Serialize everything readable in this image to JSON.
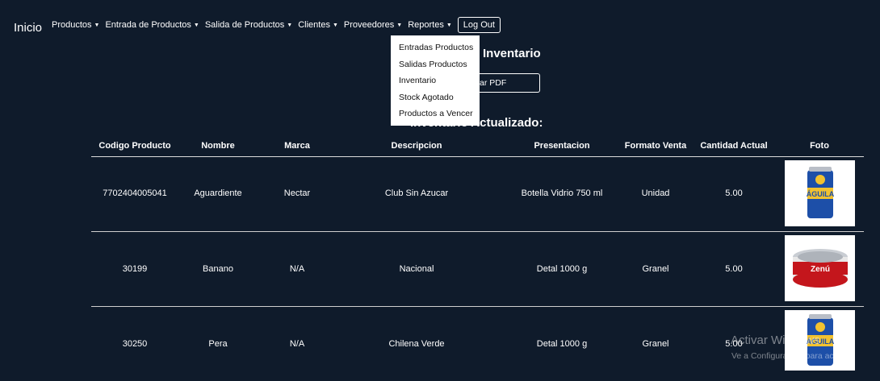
{
  "navbar": {
    "brand": "Inicio",
    "items": [
      {
        "label": "Productos"
      },
      {
        "label": "Entrada de Productos"
      },
      {
        "label": "Salida de Productos"
      },
      {
        "label": "Clientes"
      },
      {
        "label": "Proveedores"
      },
      {
        "label": "Reportes"
      }
    ],
    "logout_label": "Log Out",
    "dropdown_items": [
      "Entradas Productos",
      "Salidas Productos",
      "Inventario",
      "Stock Agotado",
      "Productos a Vencer"
    ]
  },
  "page": {
    "title": "Inventario",
    "pdf_button_label": "ar PDF",
    "subtitle": "Inventario Actualizado:"
  },
  "table": {
    "headers": [
      "Codigo Producto",
      "Nombre",
      "Marca",
      "Descripcion",
      "Presentacion",
      "Formato Venta",
      "Cantidad Actual",
      "Foto"
    ],
    "rows": [
      {
        "codigo": "7702404005041",
        "nombre": "Aguardiente",
        "marca": "Nectar",
        "descripcion": "Club Sin Azucar",
        "presentacion": "Botella Vidrio 750 ml",
        "formato": "Unidad",
        "cantidad": "5.00",
        "foto_label": "ÁGUILA"
      },
      {
        "codigo": "30199",
        "nombre": "Banano",
        "marca": "N/A",
        "descripcion": "Nacional",
        "presentacion": "Detal 1000 g",
        "formato": "Granel",
        "cantidad": "5.00",
        "foto_label": "Zenú"
      },
      {
        "codigo": "30250",
        "nombre": "Pera",
        "marca": "N/A",
        "descripcion": "Chilena Verde",
        "presentacion": "Detal 1000 g",
        "formato": "Granel",
        "cantidad": "5.00",
        "foto_label": "ÁGUILA"
      }
    ]
  },
  "watermark": {
    "line1": "Activar Windows",
    "line2": "Ve a Configuración para activar"
  },
  "colors": {
    "background": "#0f1b2b",
    "text": "#ffffff",
    "dropdown_bg": "#ffffff",
    "can_blue": "#1d4fa8",
    "can_yellow": "#f2c230",
    "tin_red": "#c4161c"
  }
}
